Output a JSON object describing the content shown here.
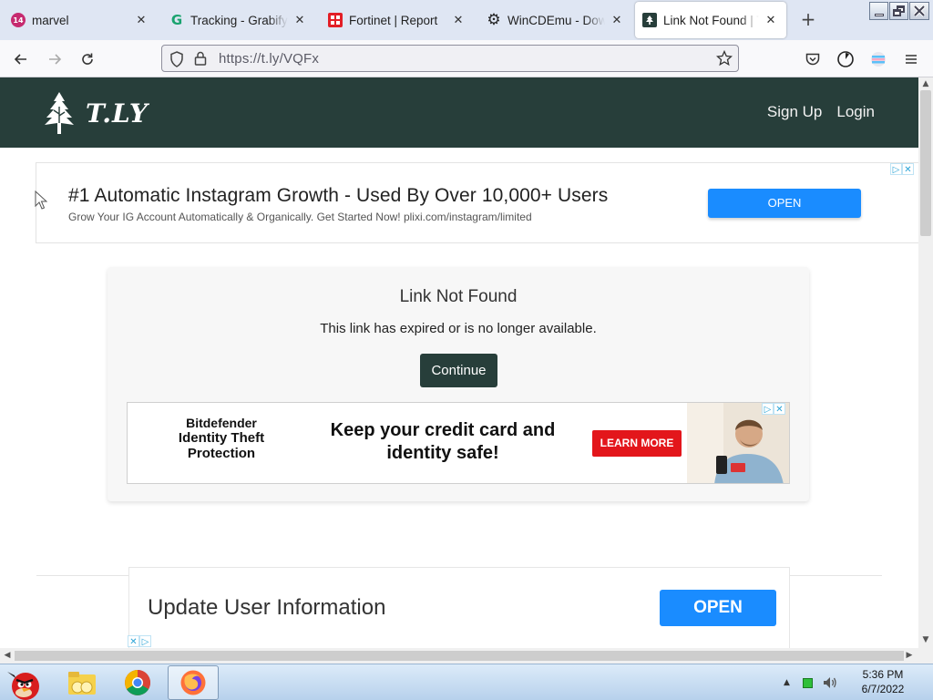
{
  "browser": {
    "tabs": [
      {
        "title": "marvel",
        "favicon": "marvel-badge-icon",
        "badge": "14",
        "active": false
      },
      {
        "title": "Tracking - Grabify IP",
        "favicon": "grabify-g-icon",
        "active": false
      },
      {
        "title": "Fortinet | Report",
        "favicon": "fortinet-icon",
        "active": false
      },
      {
        "title": "WinCDEmu - Downl",
        "favicon": "gear-icon",
        "active": false
      },
      {
        "title": "Link Not Found | T.L",
        "favicon": "tly-tree-icon",
        "active": true
      }
    ],
    "url": "https://t.ly/VQFx",
    "colors": {
      "tabstrip": "#dfe6f3",
      "accent": "#273e3a"
    }
  },
  "site": {
    "brand": "T.LY",
    "nav": {
      "signup": "Sign Up",
      "login": "Login"
    }
  },
  "ad_top": {
    "headline": "#1 Automatic Instagram Growth - Used By Over 10,000+ Users",
    "subtext": "Grow Your IG Account Automatically & Organically. Get Started Now! plixi.com/instagram/limited",
    "button": "OPEN"
  },
  "message": {
    "title": "Link Not Found",
    "body": "This link has expired or is no longer available.",
    "button": "Continue"
  },
  "ad_middle": {
    "brand_line1": "Bitdefender",
    "brand_line2": "Identity Theft Protection",
    "headline": "Keep your credit card and identity safe!",
    "button": "LEARN MORE"
  },
  "ad_bottom": {
    "headline": "Update User Information",
    "button": "OPEN"
  },
  "taskbar": {
    "time": "5:36 PM",
    "date": "6/7/2022"
  }
}
